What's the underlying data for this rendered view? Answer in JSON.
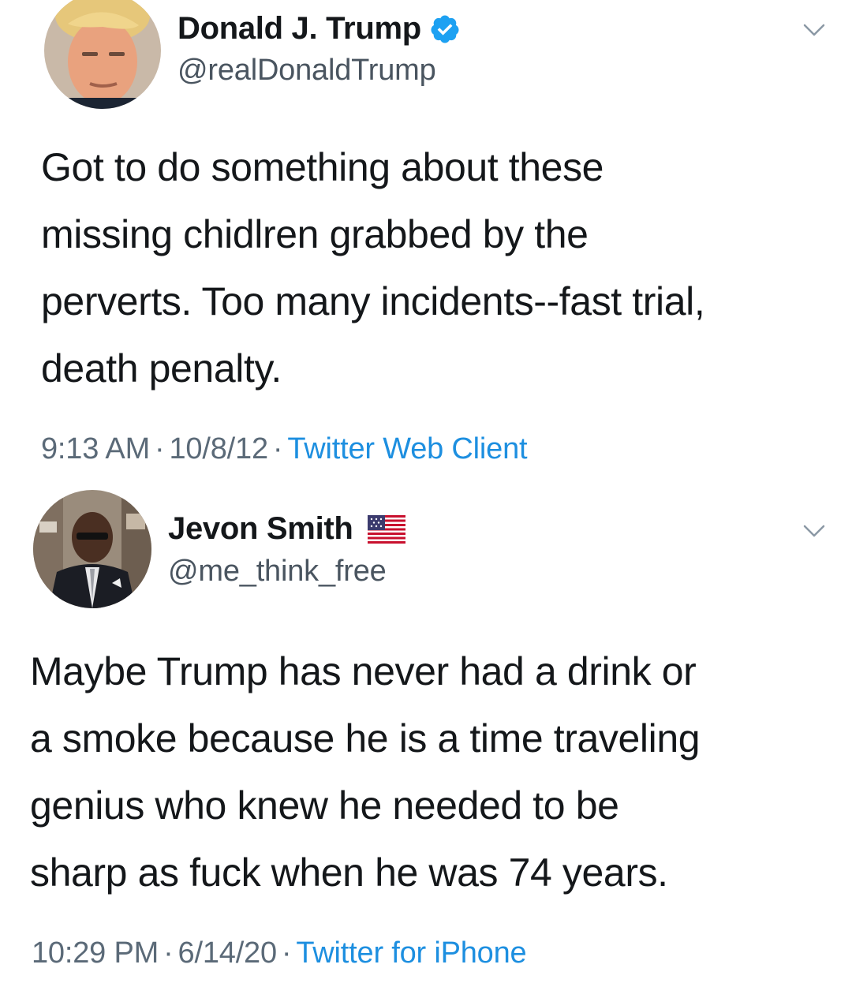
{
  "tweets": [
    {
      "display_name": "Donald J. Trump",
      "handle": "@realDonaldTrump",
      "badge": "verified-icon",
      "text": "Got to do something about these\nmissing chidlren grabbed by the\nperverts. Too many incidents--fast trial,\ndeath penalty.",
      "time": "9:13 AM",
      "date": "10/8/12",
      "source": "Twitter Web Client",
      "separator": "·"
    },
    {
      "display_name": "Jevon Smith",
      "handle": "@me_think_free",
      "badge": "us-flag-icon",
      "text": "Maybe Trump has never had a drink or\na smoke because he is a time traveling\ngenius who knew he needed to be\nsharp as fuck when he was 74 years.",
      "time": "10:29 PM",
      "date": "6/14/20",
      "source": "Twitter for iPhone",
      "separator": "·"
    }
  ],
  "colors": {
    "text": "#14171a",
    "secondary": "#5b6a78",
    "link": "#1d8fe0",
    "verified": "#1da1f2"
  }
}
